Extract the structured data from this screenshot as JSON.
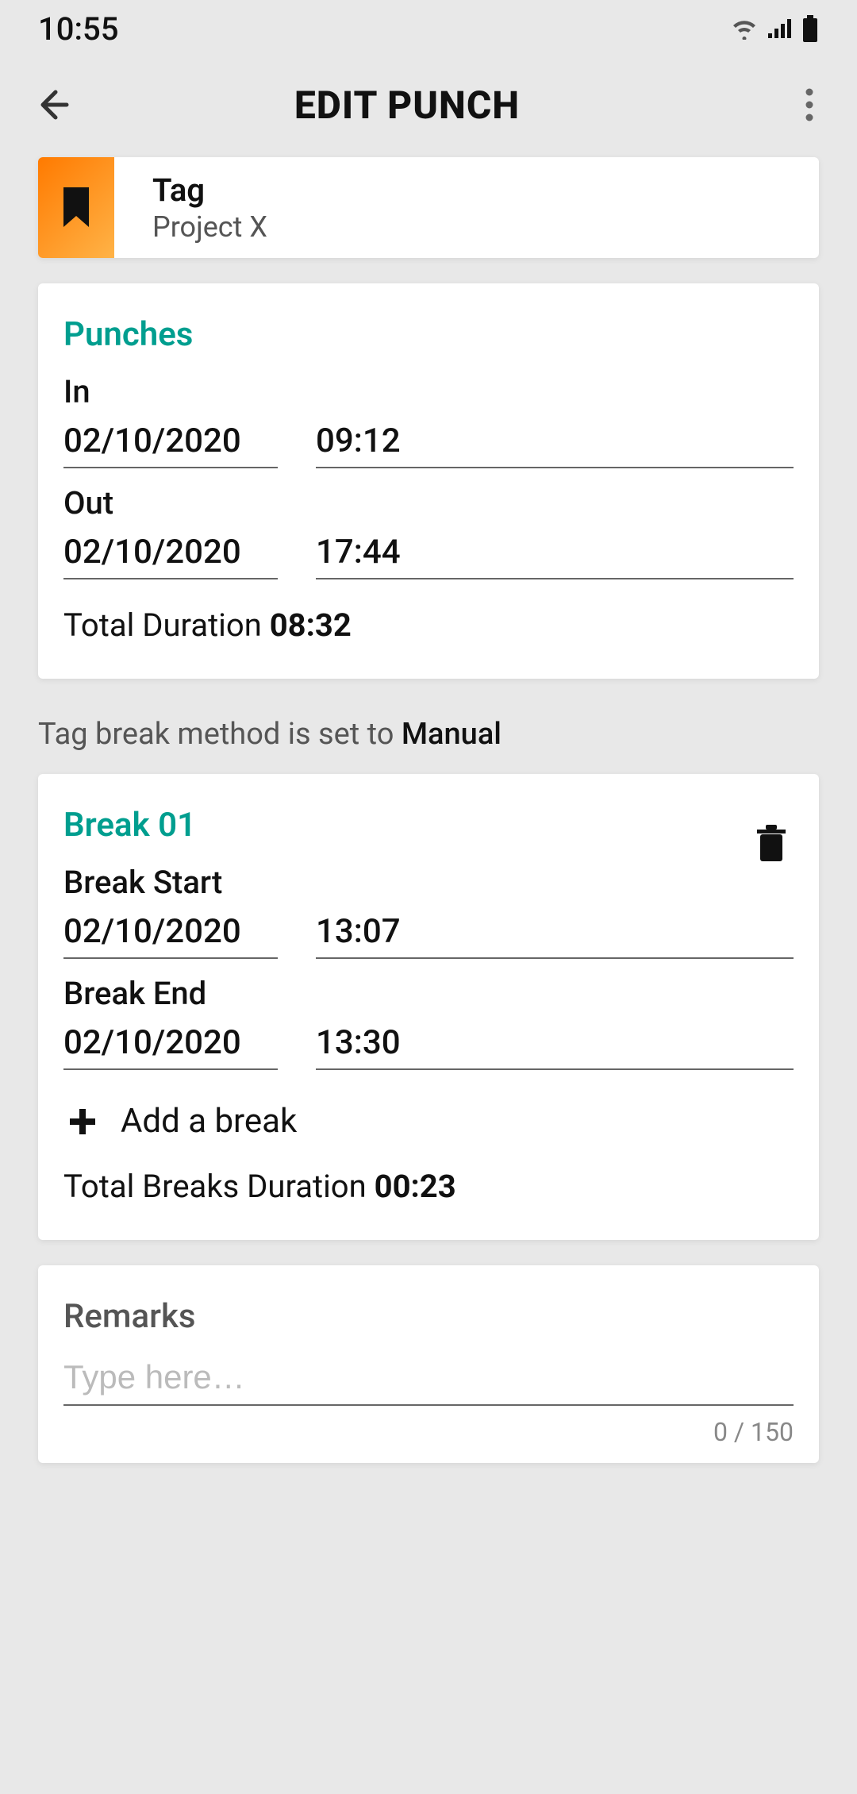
{
  "status": {
    "time": "10:55"
  },
  "appbar": {
    "title": "EDIT PUNCH"
  },
  "tag": {
    "label": "Tag",
    "value": "Project X"
  },
  "punches": {
    "section_title": "Punches",
    "in_label": "In",
    "in_date": "02/10/2020",
    "in_time": "09:12",
    "out_label": "Out",
    "out_date": "02/10/2020",
    "out_time": "17:44",
    "duration_label": "Total Duration ",
    "duration_value": "08:32"
  },
  "note": {
    "prefix": "Tag break method is set to ",
    "mode": "Manual"
  },
  "break": {
    "section_title": "Break 01",
    "start_label": "Break Start",
    "start_date": "02/10/2020",
    "start_time": "13:07",
    "end_label": "Break End",
    "end_date": "02/10/2020",
    "end_time": "13:30",
    "add_label": "Add a break",
    "total_label": "Total Breaks Duration ",
    "total_value": "00:23"
  },
  "remarks": {
    "title": "Remarks",
    "placeholder": "Type here…",
    "counter": "0 / 150"
  }
}
